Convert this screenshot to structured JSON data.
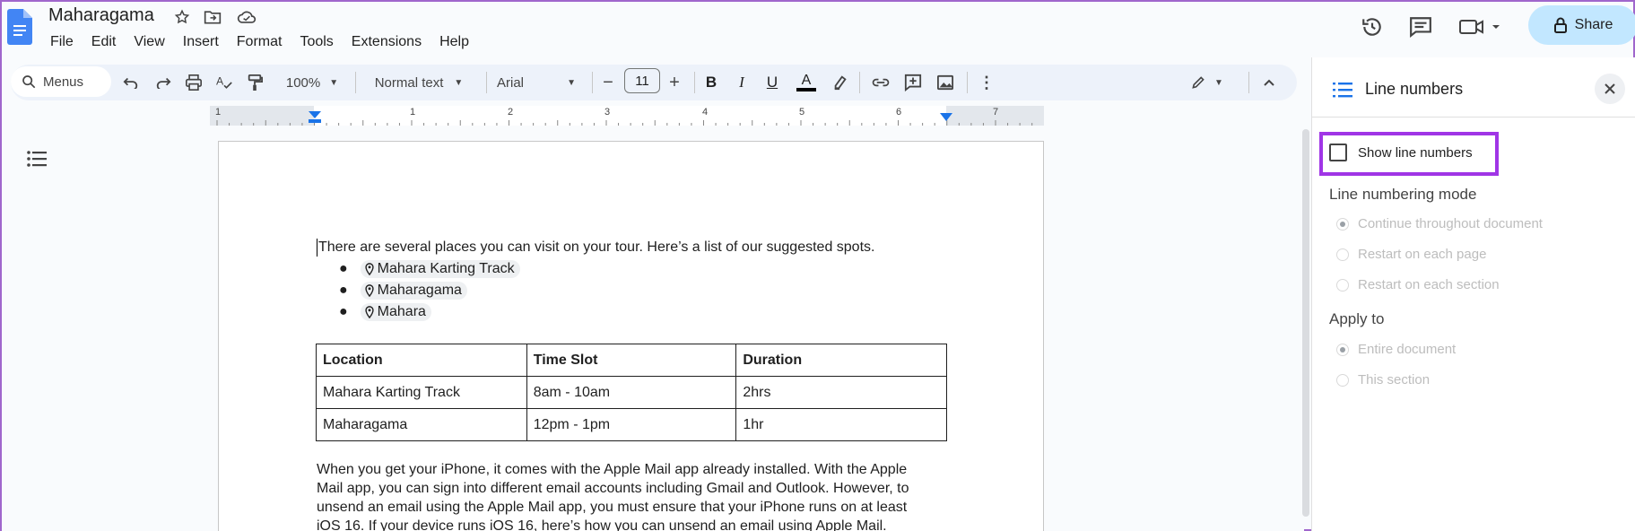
{
  "doc": {
    "title": "Maharagama"
  },
  "menubar": [
    "File",
    "Edit",
    "View",
    "Insert",
    "Format",
    "Tools",
    "Extensions",
    "Help"
  ],
  "header": {
    "share_label": "Share"
  },
  "toolbar": {
    "menus_label": "Menus",
    "zoom": "100%",
    "style": "Normal text",
    "font": "Arial",
    "font_size": "11"
  },
  "ruler": [
    "1",
    "1",
    "2",
    "3",
    "4",
    "5",
    "6",
    "7"
  ],
  "content": {
    "intro": "There are several places you can visit on your tour. Here’s a list of our suggested spots.",
    "places": [
      "Mahara Karting Track",
      "Maharagama",
      "Mahara"
    ],
    "table": {
      "headers": [
        "Location",
        "Time Slot",
        "Duration"
      ],
      "rows": [
        [
          "Mahara Karting Track",
          "8am - 10am",
          "2hrs"
        ],
        [
          "Maharagama",
          "12pm - 1pm",
          "1hr"
        ]
      ]
    },
    "para_lines": [
      "When you get your iPhone, it comes with the Apple Mail app already installed. With the Apple",
      "Mail app, you can sign into different email accounts including Gmail and Outlook. However, to",
      "unsend an email using the Apple Mail app, you must ensure that your iPhone runs on at least",
      "iOS 16. If your device runs iOS 16, here’s how you can unsend an email using Apple Mail."
    ]
  },
  "panel": {
    "title": "Line numbers",
    "show_line_numbers": "Show line numbers",
    "mode_heading": "Line numbering mode",
    "mode_options": [
      "Continue throughout document",
      "Restart on each page",
      "Restart on each section"
    ],
    "apply_heading": "Apply to",
    "apply_options": [
      "Entire document",
      "This section"
    ]
  },
  "colors": {
    "accent": "#0b57d0",
    "share_bg": "#c2e7ff",
    "highlight_border": "#a035e6",
    "toolbar_bg": "#edf2fa"
  }
}
